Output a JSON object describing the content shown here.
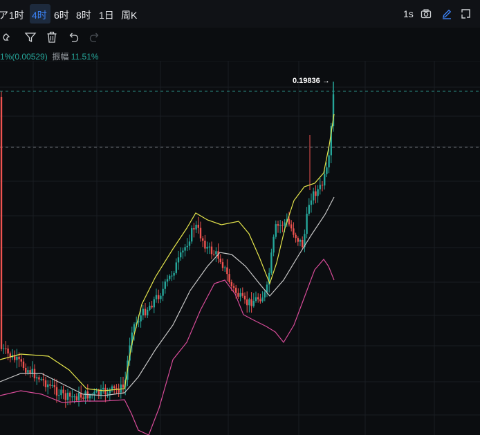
{
  "toolbar": {
    "timeframes": [
      "1时",
      "4时",
      "6时",
      "8时",
      "1日",
      "周K"
    ],
    "active": "4时",
    "interval_label": "1s"
  },
  "icons": [
    "camera-icon",
    "pen-icon",
    "fullscreen-icon",
    "magnet-icon",
    "filter-icon",
    "trash-icon",
    "undo-icon",
    "redo-icon"
  ],
  "info": {
    "change": "1%(0.00529)",
    "amplitude_label": "振幅",
    "amplitude_value": "11.51%"
  },
  "price_line": {
    "label": "0.19836 →"
  },
  "colors": {
    "up": "#26a69a",
    "down": "#ef5350",
    "ma_yellow": "#e6e64c",
    "ma_white": "#c8c8c8",
    "ma_pink": "#d94c9a",
    "active_tab": "#3b82f6"
  }
}
